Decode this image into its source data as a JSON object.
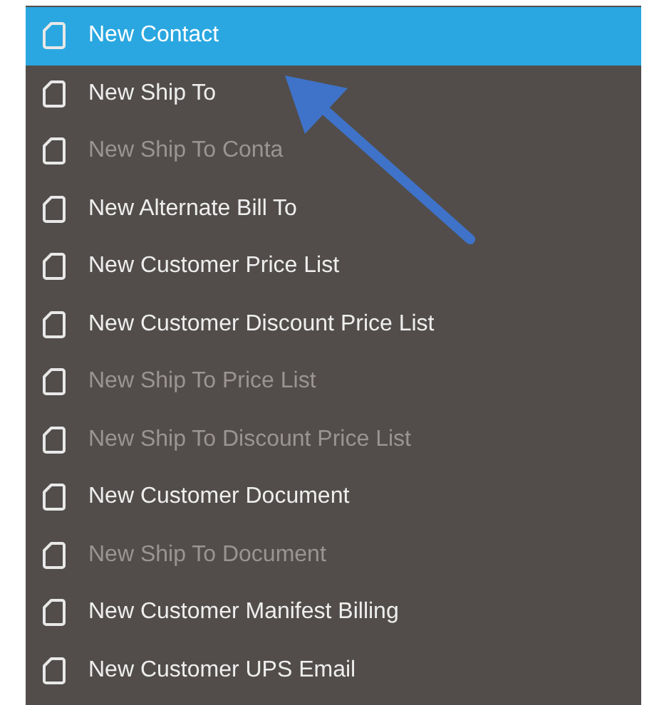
{
  "menu": {
    "items": [
      {
        "label": "New Contact",
        "selected": true,
        "disabled": false
      },
      {
        "label": "New Ship To",
        "selected": false,
        "disabled": false
      },
      {
        "label": "New Ship To Conta",
        "selected": false,
        "disabled": true
      },
      {
        "label": "New Alternate Bill To",
        "selected": false,
        "disabled": false
      },
      {
        "label": "New Customer Price List",
        "selected": false,
        "disabled": false
      },
      {
        "label": "New Customer Discount Price List",
        "selected": false,
        "disabled": false
      },
      {
        "label": "New Ship To Price List",
        "selected": false,
        "disabled": true
      },
      {
        "label": "New Ship To Discount Price List",
        "selected": false,
        "disabled": true
      },
      {
        "label": "New Customer Document",
        "selected": false,
        "disabled": false
      },
      {
        "label": "New Ship To Document",
        "selected": false,
        "disabled": true
      },
      {
        "label": "New Customer Manifest Billing",
        "selected": false,
        "disabled": false
      },
      {
        "label": "New Customer UPS Email",
        "selected": false,
        "disabled": false
      }
    ]
  }
}
